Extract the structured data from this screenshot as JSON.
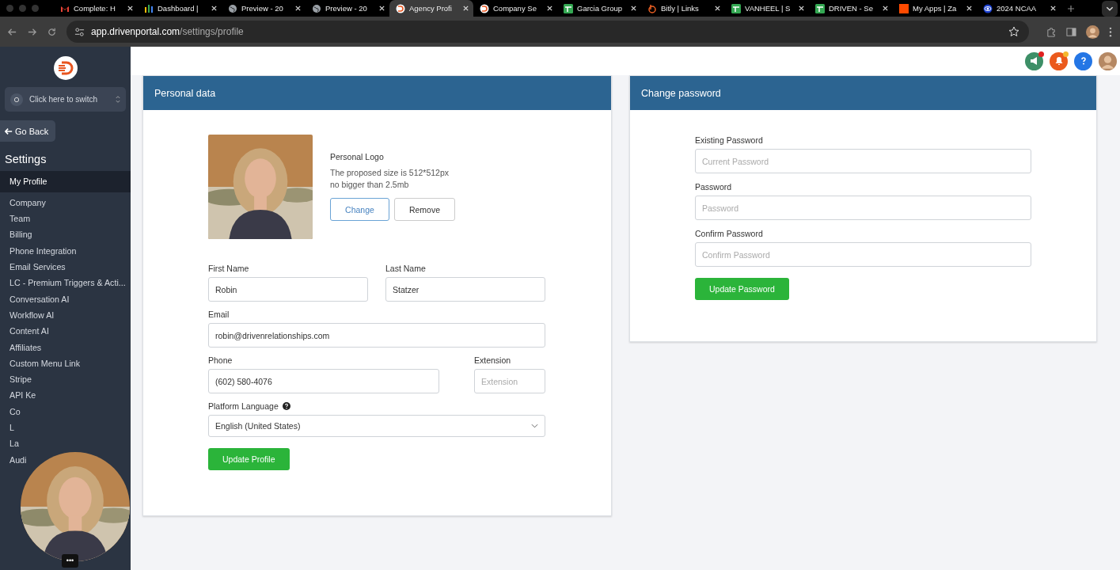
{
  "browser": {
    "tabs": [
      {
        "label": "Complete: H",
        "kind": "mail",
        "selected": false
      },
      {
        "label": "Dashboard |",
        "kind": "bars",
        "selected": false
      },
      {
        "label": "Preview - 20",
        "kind": "globe",
        "selected": false
      },
      {
        "label": "Preview - 20",
        "kind": "globe",
        "selected": false
      },
      {
        "label": "Agency Profi",
        "kind": "brand",
        "selected": true
      },
      {
        "label": "Company Se",
        "kind": "brand",
        "selected": false
      },
      {
        "label": "Garcia Group",
        "kind": "sheet",
        "selected": false
      },
      {
        "label": "Bitly | Links",
        "kind": "bitly",
        "selected": false
      },
      {
        "label": "VANHEEL | S",
        "kind": "sheet",
        "selected": false
      },
      {
        "label": "DRIVEN - Se",
        "kind": "sheet",
        "selected": false
      },
      {
        "label": "My Apps | Za",
        "kind": "square",
        "selected": false
      },
      {
        "label": "2024 NCAA",
        "kind": "eye",
        "selected": false
      }
    ],
    "url_host": "app.drivenportal.com",
    "url_path": "/settings/profile"
  },
  "sidebar": {
    "switcher": "Click here to switch",
    "back": "Go Back",
    "heading": "Settings",
    "items": [
      {
        "label": "My Profile",
        "selected": true
      },
      {
        "label": "Company",
        "selected": false
      },
      {
        "label": "Team",
        "selected": false
      },
      {
        "label": "Billing",
        "selected": false
      },
      {
        "label": "Phone Integration",
        "selected": false
      },
      {
        "label": "Email Services",
        "selected": false
      },
      {
        "label": "LC - Premium Triggers & Acti...",
        "selected": false
      },
      {
        "label": "Conversation AI",
        "selected": false
      },
      {
        "label": "Workflow AI",
        "selected": false
      },
      {
        "label": "Content AI",
        "selected": false
      },
      {
        "label": "Affiliates",
        "selected": false
      },
      {
        "label": "Custom Menu Link",
        "selected": false
      },
      {
        "label": "Stripe",
        "selected": false
      },
      {
        "label": "API Ke",
        "selected": false
      },
      {
        "label": "Co",
        "selected": false
      },
      {
        "label": "L",
        "selected": false
      },
      {
        "label": "La",
        "selected": false
      },
      {
        "label": "Audi",
        "selected": false
      }
    ]
  },
  "personal": {
    "title": "Personal data",
    "logo_title": "Personal Logo",
    "logo_hint_1": "The proposed size is 512*512px",
    "logo_hint_2": "no bigger than 2.5mb",
    "change": "Change",
    "remove": "Remove",
    "fields": [
      {
        "label": "First Name",
        "value": "Robin",
        "kind": "text"
      },
      {
        "label": "Last Name",
        "value": "Statzer",
        "kind": "text"
      },
      {
        "label": "Email",
        "value": "robin@drivenrelationships.com",
        "kind": "text"
      },
      {
        "label": "Phone",
        "value": "(602) 580-4076",
        "kind": "text"
      },
      {
        "label": "Extension",
        "placeholder": "Extension",
        "kind": "text"
      },
      {
        "label": "Platform Language",
        "value": "English (United States)",
        "kind": "select"
      }
    ],
    "submit": "Update Profile"
  },
  "password": {
    "title": "Change password",
    "fields": [
      {
        "label": "Existing Password",
        "placeholder": "Current Password"
      },
      {
        "label": "Password",
        "placeholder": "Password"
      },
      {
        "label": "Confirm Password",
        "placeholder": "Confirm Password"
      }
    ],
    "submit": "Update Password"
  },
  "video_menu": "•••"
}
